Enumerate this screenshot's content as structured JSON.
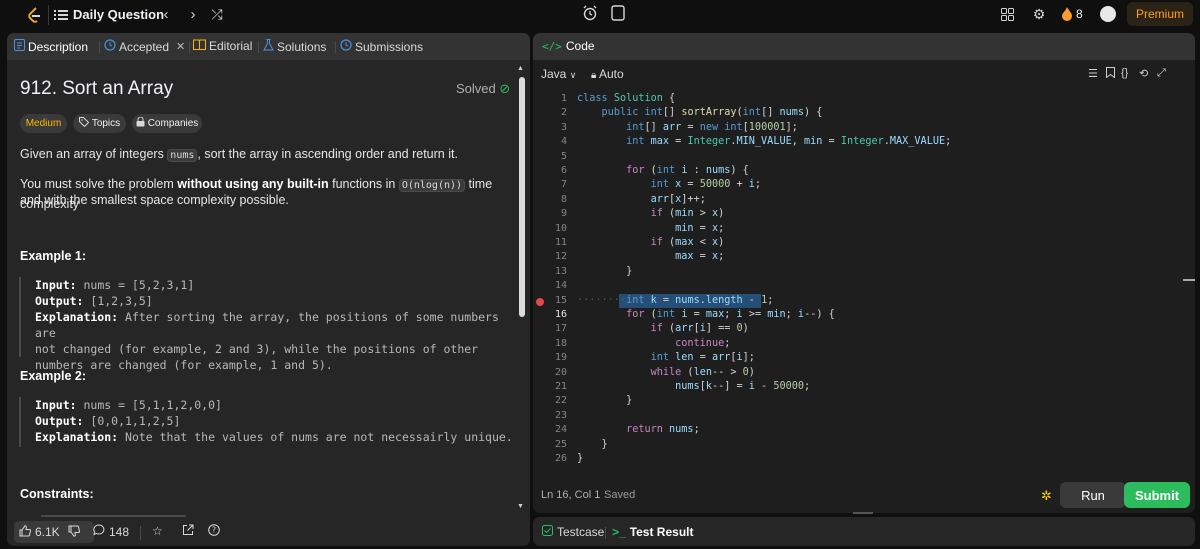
{
  "topnav": {
    "daily_question": "Daily Question",
    "streak": "8",
    "premium": "Premium"
  },
  "tabs": {
    "description": "Description",
    "accepted": "Accepted",
    "editorial": "Editorial",
    "solutions": "Solutions",
    "submissions": "Submissions"
  },
  "problem": {
    "title": "912. Sort an Array",
    "status": "Solved",
    "difficulty": "Medium",
    "topics": "Topics",
    "companies": "Companies",
    "p1_pre": "Given an array of integers ",
    "p1_code": "nums",
    "p1_post": ", sort the array in ascending order and return it.",
    "p2_pre": "You must solve the problem ",
    "p2_bold": "without using any built-in",
    "p2_mid": " functions in ",
    "p2_code": "O(nlog(n))",
    "p2_post": " time complexity",
    "p2_line2": "and with the smallest space complexity possible.",
    "example1_heading": "Example 1:",
    "example1": {
      "input_label": "Input:",
      "input": " nums = [5,2,3,1]",
      "output_label": "Output:",
      "output": " [1,2,3,5]",
      "explanation_label": "Explanation:",
      "explanation_l1": " After sorting the array, the positions of some numbers are",
      "explanation_l2": "not changed (for example, 2 and 3), while the positions of other",
      "explanation_l3": "numbers are changed (for example, 1 and 5)."
    },
    "example2_heading": "Example 2:",
    "example2": {
      "input_label": "Input:",
      "input": " nums = [5,1,1,2,0,0]",
      "output_label": "Output:",
      "output": " [0,0,1,1,2,5]",
      "explanation_label": "Explanation:",
      "explanation": " Note that the values of nums are not necessairly unique."
    },
    "constraints_heading": "Constraints:"
  },
  "footer": {
    "likes": "6.1K",
    "comments": "148"
  },
  "editor": {
    "tab": "Code",
    "language": "Java",
    "mode": "Auto",
    "status": "Ln 16, Col 1",
    "saved": "Saved",
    "run": "Run",
    "submit": "Submit",
    "breakpoint_line": 15,
    "current_line": 16,
    "line_numbers": [
      "1",
      "2",
      "3",
      "4",
      "5",
      "6",
      "7",
      "8",
      "9",
      "10",
      "11",
      "12",
      "13",
      "14",
      "15",
      "16",
      "17",
      "18",
      "19",
      "20",
      "21",
      "22",
      "23",
      "24",
      "25",
      "26"
    ]
  },
  "bottom": {
    "testcase": "Testcase",
    "test_result": "Test Result"
  },
  "colors": {
    "accent_green": "#2cbb5d",
    "accent_orange": "#ffa116",
    "medium": "#ffb800",
    "breakpoint": "#e5484d",
    "selection": "#264f78"
  }
}
